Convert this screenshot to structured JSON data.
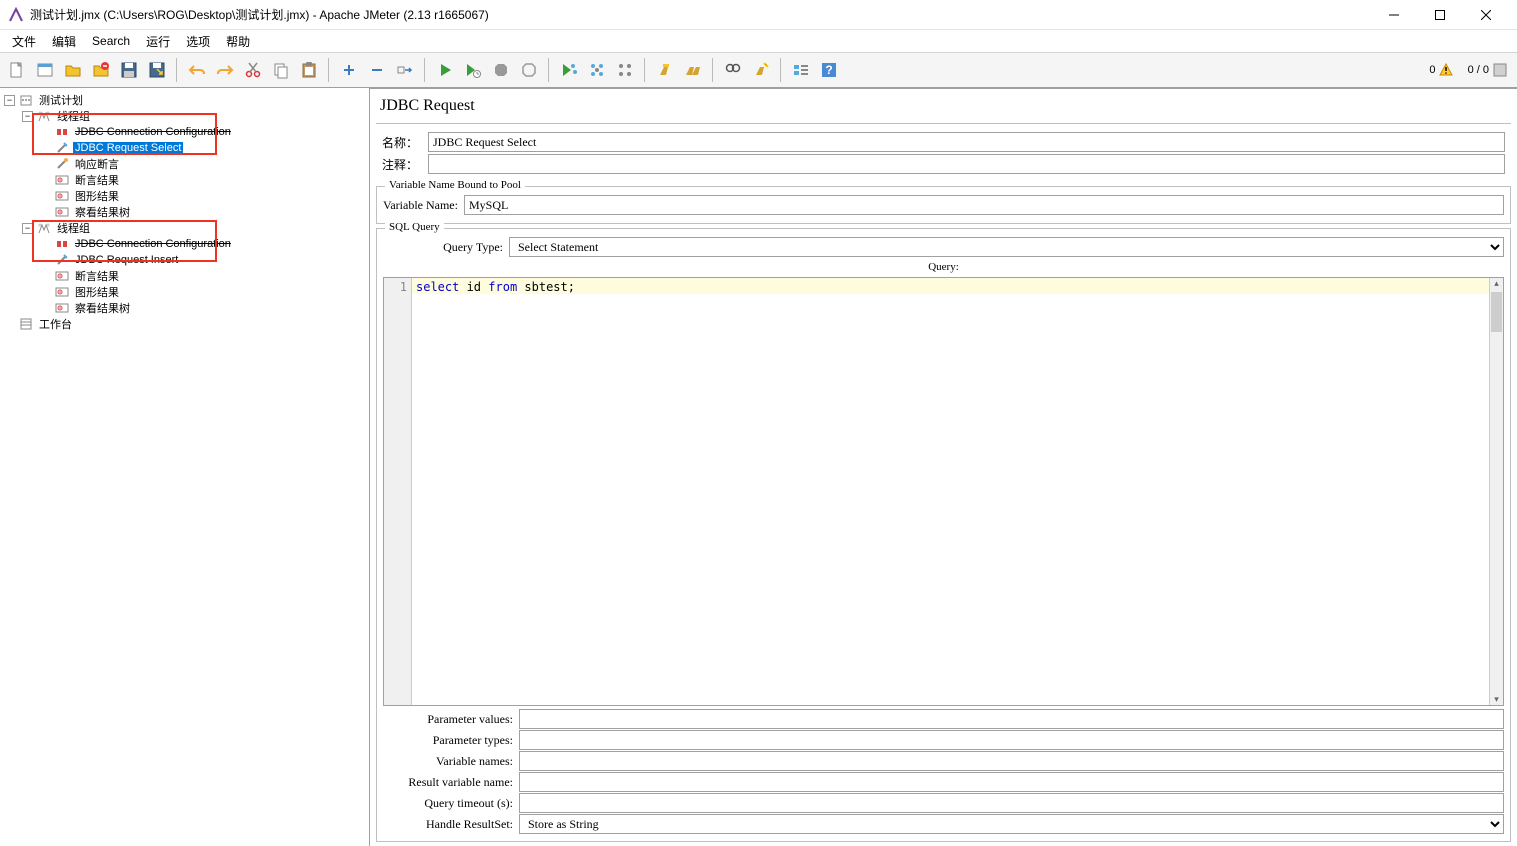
{
  "window": {
    "title": "测试计划.jmx (C:\\Users\\ROG\\Desktop\\测试计划.jmx) - Apache JMeter (2.13 r1665067)"
  },
  "menu": {
    "file": "文件",
    "edit": "编辑",
    "search": "Search",
    "run": "运行",
    "options": "选项",
    "help": "帮助"
  },
  "status": {
    "warn_count": "0",
    "threads": "0 / 0"
  },
  "tree": {
    "test_plan": "测试计划",
    "thread_group": "线程组",
    "jdbc_conn": "JDBC Connection Configuration",
    "jdbc_req_select": "JDBC Request Select",
    "response_assert": "响应断言",
    "assertion_results": "断言结果",
    "graph_results": "图形结果",
    "view_results_tree": "察看结果树",
    "jdbc_req_insert": "JDBC Request Insert",
    "workbench": "工作台"
  },
  "panel": {
    "title": "JDBC Request",
    "name_label": "名称：",
    "name_value": "JDBC Request Select",
    "comment_label": "注释：",
    "comment_value": "",
    "pool_legend": "Variable Name Bound to Pool",
    "var_name_label": "Variable Name:",
    "var_name_value": "MySQL",
    "sql_legend": "SQL Query",
    "query_type_label": "Query Type:",
    "query_type_value": "Select Statement",
    "query_label": "Query:",
    "query_text": "select id from sbtest;",
    "param_values": "Parameter values:",
    "param_types": "Parameter types:",
    "var_names": "Variable names:",
    "result_var": "Result variable name:",
    "timeout": "Query timeout (s):",
    "handle_rs_label": "Handle ResultSet:",
    "handle_rs_value": "Store as String"
  }
}
